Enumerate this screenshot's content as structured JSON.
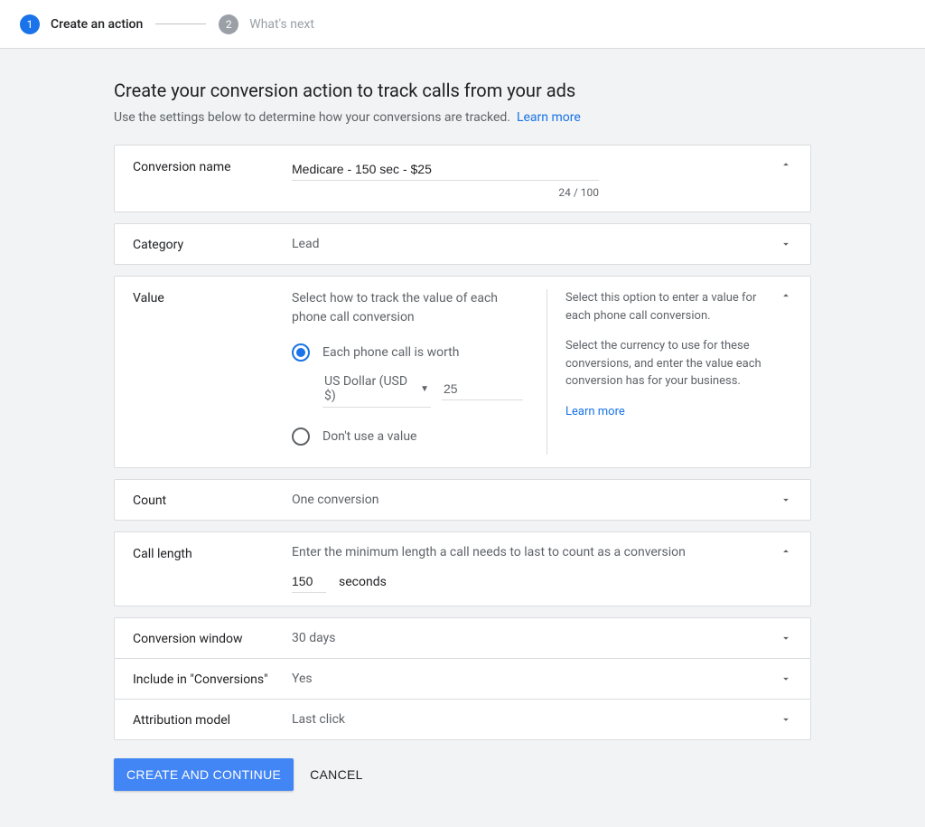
{
  "stepper": {
    "step1_num": "1",
    "step1_label": "Create an action",
    "step2_num": "2",
    "step2_label": "What's next"
  },
  "header": {
    "title": "Create your conversion action to track calls from your ads",
    "subtitle": "Use the settings below to determine how your conversions are tracked.",
    "learn_more": "Learn more"
  },
  "name_card": {
    "label": "Conversion name",
    "value": "Medicare - 150 sec - $25",
    "char_count": "24 / 100"
  },
  "category_card": {
    "label": "Category",
    "value": "Lead"
  },
  "value_card": {
    "label": "Value",
    "description": "Select how to track the value of each phone call conversion",
    "radio_each": "Each phone call is worth",
    "currency": "US Dollar (USD $)",
    "amount": "25",
    "radio_none": "Don't use a value",
    "help1": "Select this option to enter a value for each phone call conversion.",
    "help2": "Select the currency to use for these conversions, and enter the value each conversion has for your business.",
    "help_link": "Learn more"
  },
  "count_card": {
    "label": "Count",
    "value": "One conversion"
  },
  "call_card": {
    "label": "Call length",
    "description": "Enter the minimum length a call needs to last to count as a conversion",
    "value": "150",
    "unit": "seconds"
  },
  "window_card": {
    "label": "Conversion window",
    "value": "30 days"
  },
  "include_card": {
    "label": "Include in \"Conversions\"",
    "value": "Yes"
  },
  "attribution_card": {
    "label": "Attribution model",
    "value": "Last click"
  },
  "actions": {
    "primary": "CREATE AND CONTINUE",
    "cancel": "CANCEL"
  }
}
